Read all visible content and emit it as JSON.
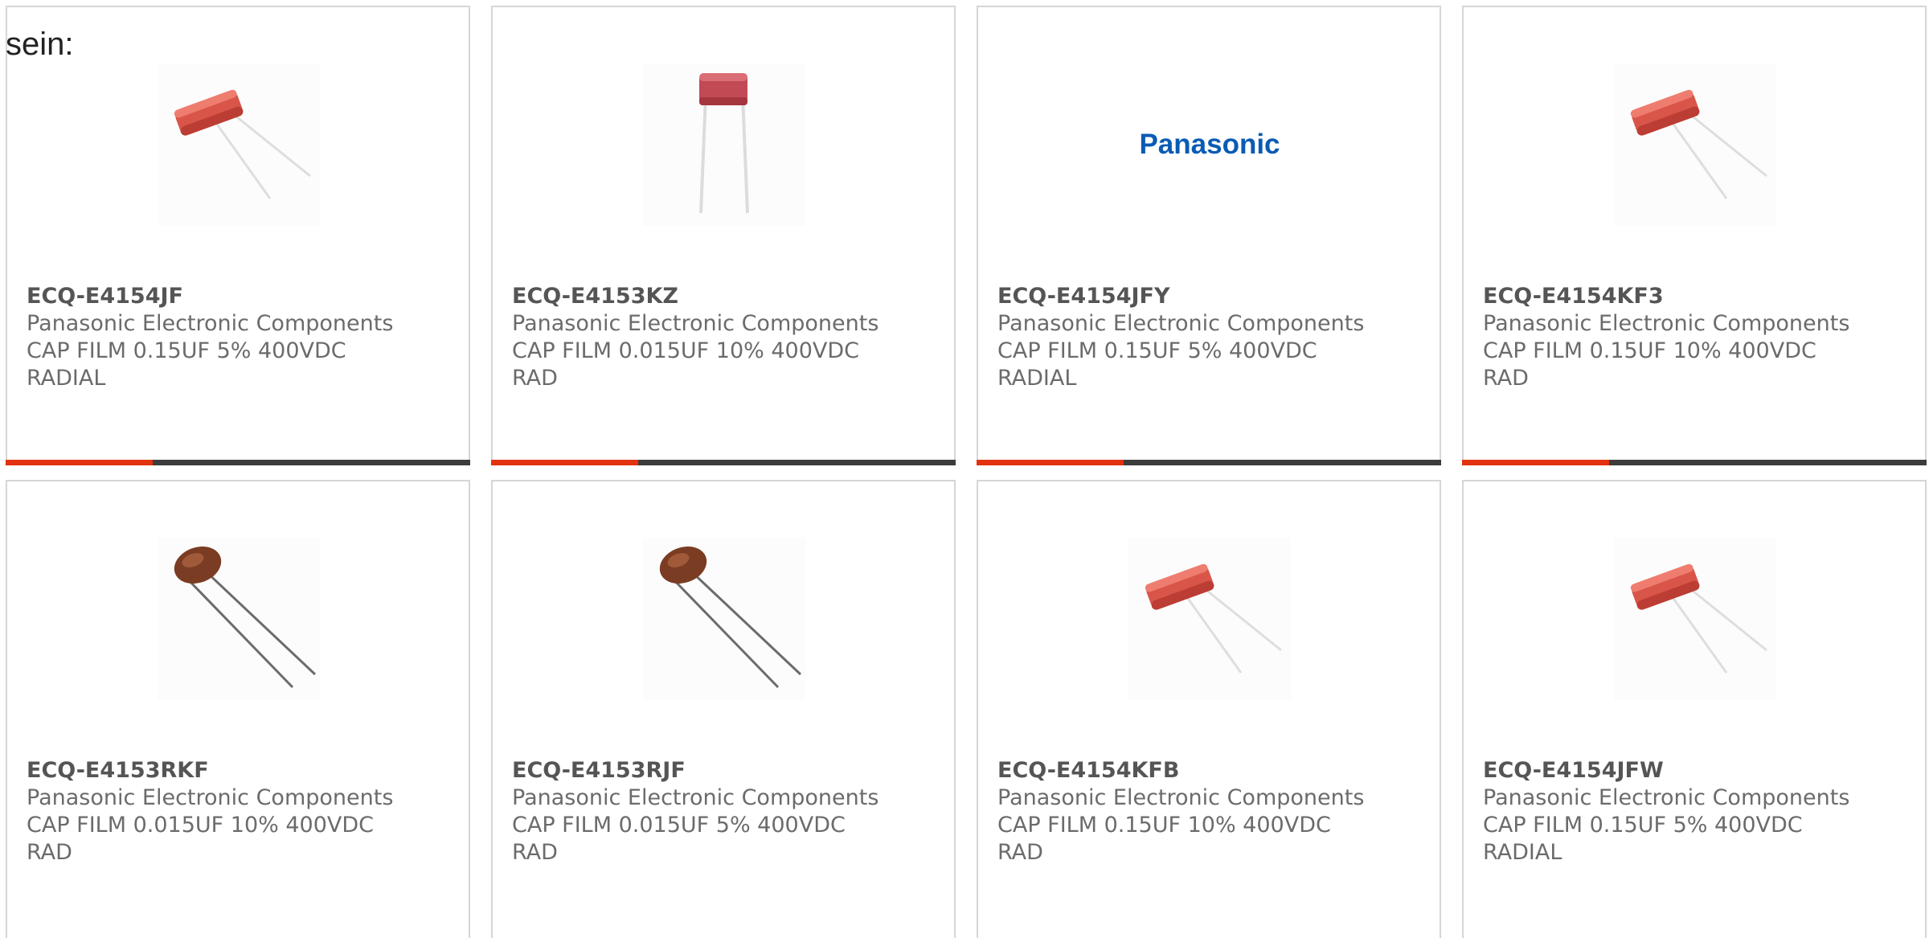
{
  "intro_text": "sein:",
  "colors": {
    "accent_bar": "#e2320f",
    "bar_base": "#3c3c3c",
    "panasonic_blue": "#0a5bb4"
  },
  "products": [
    {
      "part_number": "ECQ-E4154JF",
      "manufacturer": "Panasonic Electronic Components",
      "desc_line1": "CAP FILM 0.15UF 5% 400VDC",
      "desc_line2": "RADIAL",
      "image": "red-box-film-capacitor"
    },
    {
      "part_number": "ECQ-E4153KZ",
      "manufacturer": "Panasonic Electronic Components",
      "desc_line1": "CAP FILM 0.015UF 10% 400VDC",
      "desc_line2": "RAD",
      "image": "red-upright-film-capacitor"
    },
    {
      "part_number": "ECQ-E4154JFY",
      "manufacturer": "Panasonic Electronic Components",
      "desc_line1": "CAP FILM 0.15UF 5% 400VDC",
      "desc_line2": "RADIAL",
      "image": "panasonic-logo",
      "logo_text": "Panasonic"
    },
    {
      "part_number": "ECQ-E4154KF3",
      "manufacturer": "Panasonic Electronic Components",
      "desc_line1": "CAP FILM 0.15UF 10% 400VDC",
      "desc_line2": "RAD",
      "image": "red-box-film-capacitor"
    },
    {
      "part_number": "ECQ-E4153RKF",
      "manufacturer": "Panasonic Electronic Components",
      "desc_line1": "CAP FILM 0.015UF 10% 400VDC",
      "desc_line2": "RAD",
      "image": "brown-dipped-film-capacitor"
    },
    {
      "part_number": "ECQ-E4153RJF",
      "manufacturer": "Panasonic Electronic Components",
      "desc_line1": "CAP FILM 0.015UF 5% 400VDC",
      "desc_line2": "RAD",
      "image": "brown-dipped-film-capacitor"
    },
    {
      "part_number": "ECQ-E4154KFB",
      "manufacturer": "Panasonic Electronic Components",
      "desc_line1": "CAP FILM 0.15UF 10% 400VDC",
      "desc_line2": "RAD",
      "image": "red-box-film-capacitor"
    },
    {
      "part_number": "ECQ-E4154JFW",
      "manufacturer": "Panasonic Electronic Components",
      "desc_line1": "CAP FILM 0.15UF 5% 400VDC",
      "desc_line2": "RADIAL",
      "image": "red-box-film-capacitor"
    }
  ]
}
